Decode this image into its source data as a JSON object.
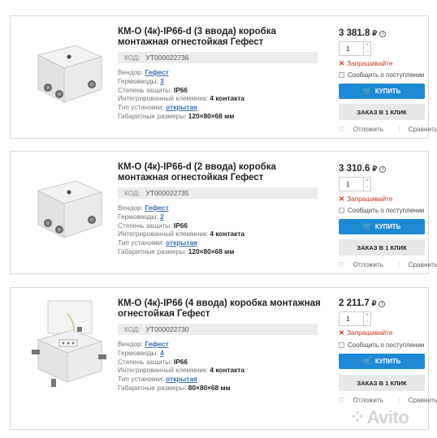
{
  "products": [
    {
      "title": "КМ-О (4к)-IP66-d (3 ввода) коробка монтажная огнестойкая Гефест",
      "code_label": "КОД:",
      "code": "УТ000022736",
      "props": [
        {
          "label": "Вендор: ",
          "value": "Гефест",
          "link": true
        },
        {
          "label": "Гермовводы: ",
          "value": "3",
          "link": true
        },
        {
          "label": "Степень защиты: ",
          "value": "IP66",
          "link": false
        },
        {
          "label": "Интегрированный клеммник: ",
          "value": "4 контакта",
          "link": false
        },
        {
          "label": "Тип установки: ",
          "value": "открытая",
          "link": true
        },
        {
          "label": "Габаритные размеры: ",
          "value": "120×80×68 мм",
          "link": false
        }
      ],
      "price": "3 381.8",
      "currency": "₽",
      "qty": "1",
      "ask": "Запрашивайте",
      "notify": "Сообщить о поступлении",
      "buy": "КУПИТЬ",
      "one_click": "ЗАКАЗ В 1 КЛИК",
      "postpone": "Отложить",
      "compare": "Сравнить"
    },
    {
      "title": "КМ-О (4к)-IP66-d (2 ввода) коробка монтажная огнестойкая Гефест",
      "code_label": "КОД:",
      "code": "УТ000022735",
      "props": [
        {
          "label": "Вендор: ",
          "value": "Гефест",
          "link": true
        },
        {
          "label": "Гермовводы: ",
          "value": "2",
          "link": true
        },
        {
          "label": "Степень защиты: ",
          "value": "IP66",
          "link": false
        },
        {
          "label": "Интегрированный клеммник: ",
          "value": "4 контакта",
          "link": false
        },
        {
          "label": "Тип установки: ",
          "value": "открытая",
          "link": true
        },
        {
          "label": "Габаритные размеры: ",
          "value": "120×80×68 мм",
          "link": false
        }
      ],
      "price": "3 310.6",
      "currency": "₽",
      "qty": "1",
      "ask": "Запрашивайте",
      "notify": "Сообщить о поступлении",
      "buy": "КУПИТЬ",
      "one_click": "ЗАКАЗ В 1 КЛИК",
      "postpone": "Отложить",
      "compare": "Сравнить"
    },
    {
      "title": "КМ-О (4к)-IP66 (4 ввода) коробка монтажная огнестойкая Гефест",
      "code_label": "КОД:",
      "code": "УТ000022730",
      "props": [
        {
          "label": "Вендор: ",
          "value": "Гефест",
          "link": true
        },
        {
          "label": "Гермовводы: ",
          "value": "4",
          "link": true
        },
        {
          "label": "Степень защиты: ",
          "value": "IP66",
          "link": false
        },
        {
          "label": "Интегрированный клеммник: ",
          "value": "4 контакта",
          "link": false
        },
        {
          "label": "Тип установки: ",
          "value": "открытая",
          "link": true
        },
        {
          "label": "Габаритные размеры: ",
          "value": "80×80×68 мм",
          "link": false
        }
      ],
      "price": "2 211.7",
      "currency": "₽",
      "qty": "1",
      "ask": "Запрашивайте",
      "notify": "Сообщить о поступлении",
      "buy": "КУПИТЬ",
      "one_click": "ЗАКАЗ В 1 КЛИК",
      "postpone": "Отложить",
      "compare": "Сравнить"
    }
  ],
  "icons": {
    "info": "info-icon",
    "cart": "cart-icon",
    "heart": "heart-icon",
    "compare": "compare-icon",
    "close": "close-icon"
  },
  "colors": {
    "accent": "#1e8ad6",
    "ask": "#d0321b",
    "link": "#3b6fb5"
  },
  "watermark": "Avito"
}
